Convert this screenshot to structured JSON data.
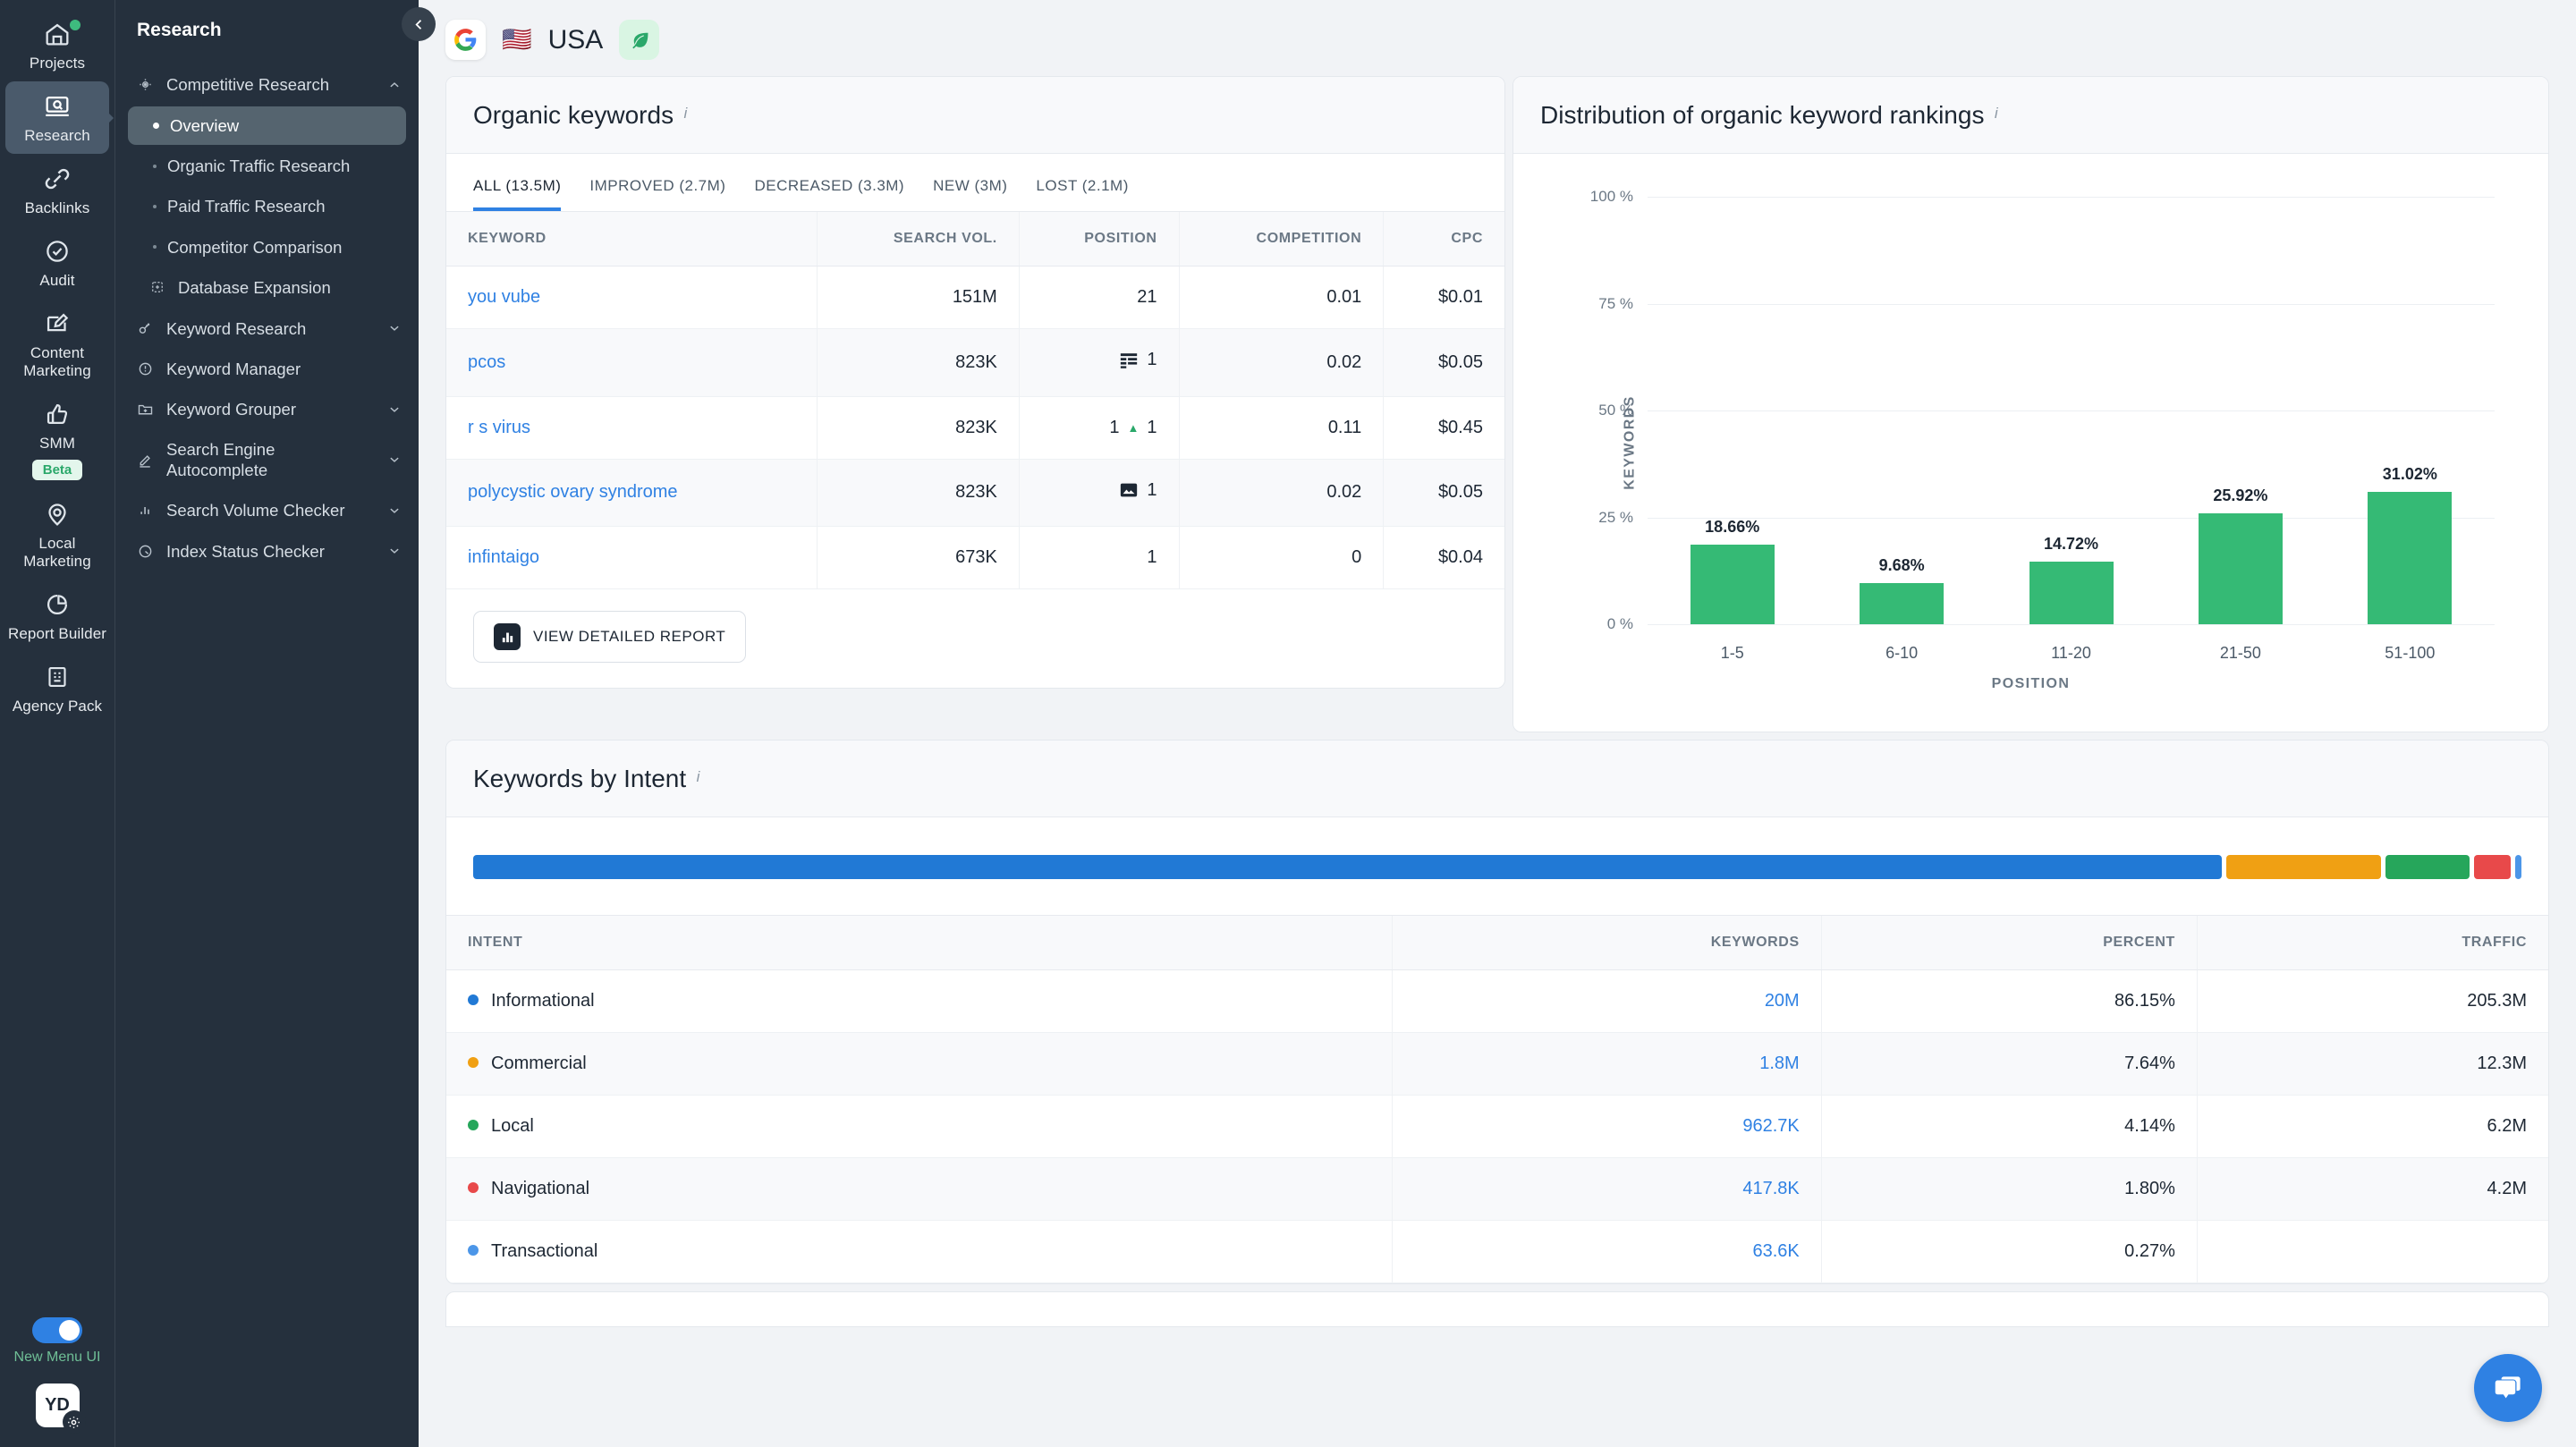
{
  "rail": {
    "items": [
      {
        "label": "Projects",
        "icon": "home-icon",
        "badge_dot": true,
        "active": false
      },
      {
        "label": "Research",
        "icon": "research-icon",
        "badge_dot": false,
        "active": true
      },
      {
        "label": "Backlinks",
        "icon": "link-icon",
        "badge_dot": false,
        "active": false
      },
      {
        "label": "Audit",
        "icon": "check-circle-icon",
        "badge_dot": false,
        "active": false
      },
      {
        "label": "Content\nMarketing",
        "icon": "edit-icon",
        "badge_dot": false,
        "active": false
      },
      {
        "label": "SMM",
        "icon": "thumbs-up-icon",
        "badge_dot": false,
        "active": false,
        "tag": "Beta"
      },
      {
        "label": "Local\nMarketing",
        "icon": "location-icon",
        "badge_dot": false,
        "active": false
      },
      {
        "label": "Report\nBuilder",
        "icon": "pie-chart-icon",
        "badge_dot": false,
        "active": false
      },
      {
        "label": "Agency\nPack",
        "icon": "building-icon",
        "badge_dot": false,
        "active": false
      }
    ],
    "toggle_label": "New Menu UI",
    "avatar_initials": "YD"
  },
  "sidebar": {
    "title": "Research",
    "groups": [
      {
        "label": "Competitive Research",
        "icon": "target-icon",
        "expanded": true,
        "children": [
          {
            "label": "Overview",
            "active": true
          },
          {
            "label": "Organic Traffic Research",
            "active": false
          },
          {
            "label": "Paid Traffic Research",
            "active": false
          },
          {
            "label": "Competitor Comparison",
            "active": false
          },
          {
            "label": "Database Expansion",
            "active": false,
            "icon": "expand-icon"
          }
        ]
      },
      {
        "label": "Keyword Research",
        "icon": "key-icon",
        "expanded": false,
        "children": []
      },
      {
        "label": "Keyword Manager",
        "icon": "clock-icon",
        "expanded": null,
        "children": []
      },
      {
        "label": "Keyword Grouper",
        "icon": "folder-plus-icon",
        "expanded": false,
        "children": []
      },
      {
        "label": "Search Engine Autocomplete",
        "icon": "pen-icon",
        "expanded": false,
        "children": []
      },
      {
        "label": "Search Volume Checker",
        "icon": "bars-icon",
        "expanded": false,
        "children": []
      },
      {
        "label": "Index Status Checker",
        "icon": "gauge-icon",
        "expanded": false,
        "children": []
      }
    ]
  },
  "topbar": {
    "engine_icon": "google-icon",
    "flag": "🇺🇸",
    "country": "USA",
    "leaf_icon": "leaf-icon"
  },
  "organic": {
    "title": "Organic keywords",
    "tabs": [
      {
        "label": "ALL (13.5M)",
        "active": true
      },
      {
        "label": "IMPROVED (2.7M)",
        "active": false
      },
      {
        "label": "DECREASED (3.3M)",
        "active": false
      },
      {
        "label": "NEW (3M)",
        "active": false
      },
      {
        "label": "LOST (2.1M)",
        "active": false
      }
    ],
    "columns": [
      "KEYWORD",
      "SEARCH VOL.",
      "POSITION",
      "COMPETITION",
      "CPC"
    ],
    "rows": [
      {
        "keyword": "you vube",
        "volume": "151M",
        "position": "21",
        "pos_icon": "",
        "pos_change": "",
        "competition": "0.01",
        "cpc": "$0.01"
      },
      {
        "keyword": "pcos",
        "volume": "823K",
        "position": "1",
        "pos_icon": "snippet-icon",
        "pos_change": "",
        "competition": "0.02",
        "cpc": "$0.05"
      },
      {
        "keyword": "r s virus",
        "volume": "823K",
        "position": "1",
        "pos_icon": "",
        "pos_change": "1",
        "competition": "0.11",
        "cpc": "$0.45"
      },
      {
        "keyword": "polycystic ovary syndrome",
        "volume": "823K",
        "position": "1",
        "pos_icon": "image-icon",
        "pos_change": "",
        "competition": "0.02",
        "cpc": "$0.05"
      },
      {
        "keyword": "infintaigo",
        "volume": "673K",
        "position": "1",
        "pos_icon": "",
        "pos_change": "",
        "competition": "0",
        "cpc": "$0.04"
      }
    ],
    "button_label": "VIEW DETAILED REPORT",
    "button_icon": "bar-chart-icon"
  },
  "distribution": {
    "title": "Distribution of organic keyword rankings"
  },
  "chart_data": {
    "type": "bar",
    "title": "Distribution of organic keyword rankings",
    "categories": [
      "1-5",
      "6-10",
      "11-20",
      "21-50",
      "51-100"
    ],
    "values": [
      18.66,
      9.68,
      14.72,
      25.92,
      31.02
    ],
    "value_labels": [
      "18.66%",
      "9.68%",
      "14.72%",
      "25.92%",
      "31.02%"
    ],
    "xlabel": "POSITION",
    "ylabel": "KEYWORDS",
    "ylim": [
      0,
      100
    ],
    "yticks": [
      0,
      25,
      50,
      75,
      100
    ],
    "ytick_labels": [
      "0 %",
      "25 %",
      "50 %",
      "75 %",
      "100 %"
    ],
    "bar_color": "#35ba75",
    "grid": true,
    "legend": "none"
  },
  "intent": {
    "title": "Keywords by Intent",
    "bar_segments": [
      {
        "name": "Informational",
        "percent": 86.15,
        "color": "#2179d5"
      },
      {
        "name": "Commercial",
        "percent": 7.64,
        "color": "#f0a013"
      },
      {
        "name": "Local",
        "percent": 4.14,
        "color": "#26a65b"
      },
      {
        "name": "Navigational",
        "percent": 1.8,
        "color": "#e8494a"
      },
      {
        "name": "Transactional",
        "percent": 0.27,
        "color": "#4c96e8"
      }
    ],
    "columns": [
      "INTENT",
      "KEYWORDS",
      "PERCENT",
      "TRAFFIC"
    ],
    "rows": [
      {
        "intent": "Informational",
        "color": "#2179d5",
        "keywords": "20M",
        "percent": "86.15%",
        "traffic": "205.3M"
      },
      {
        "intent": "Commercial",
        "color": "#f0a013",
        "keywords": "1.8M",
        "percent": "7.64%",
        "traffic": "12.3M"
      },
      {
        "intent": "Local",
        "color": "#26a65b",
        "keywords": "962.7K",
        "percent": "4.14%",
        "traffic": "6.2M"
      },
      {
        "intent": "Navigational",
        "color": "#e8494a",
        "keywords": "417.8K",
        "percent": "1.80%",
        "traffic": "4.2M"
      },
      {
        "intent": "Transactional",
        "color": "#4c96e8",
        "keywords": "63.6K",
        "percent": "0.27%",
        "traffic": ""
      }
    ]
  },
  "chat": {
    "icon": "chat-bubble-icon"
  }
}
